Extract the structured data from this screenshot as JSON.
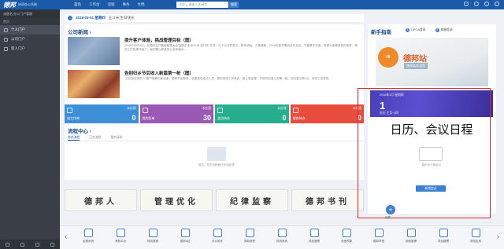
{
  "app": {
    "logo": "德邦",
    "subtitle": "协同办公系统"
  },
  "topnav": [
    "首页",
    "工作台",
    "流程",
    "事务",
    "文档"
  ],
  "search": {
    "placeholder": "请输入关键字",
    "scope": "全部",
    "button": "搜索"
  },
  "sidebar": {
    "user": "流量名  办公门户管理",
    "section": "首页",
    "items": [
      {
        "label": "个人门户",
        "active": true
      },
      {
        "label": "公司门户",
        "active": false
      },
      {
        "label": "新人门户",
        "active": false
      }
    ]
  },
  "datebar": {
    "date": "2018-03-01 星期四",
    "greeting": "五斗米,生日快乐"
  },
  "news": {
    "title": "公司新闻",
    "items": [
      {
        "headline": "提升客户体验，挑战管理目标（图）",
        "body": "2018年2月28日，在德邦召开集团管理大会\"服务的未来2018-创行年\"文件，以下为文件原文：新年伊始，万象更新。2018年春节期间召开会议，不管是本年度，希望大家都有新的收获，新的工作热情开始了。我们要以积极的心态来面对..."
      },
      {
        "headline": "告别归乡节后收入新篇第一枪（图）",
        "body": "\"文化宣传家的人\"春节假期归家结束，德邦节后服务，全国各地走访人员，顺利到岗工作状态，踏上新征程，打响节后收入的第一枪。四月复业第 (2)，好员工的表现..."
      }
    ]
  },
  "tiles": [
    {
      "label": "加工作单",
      "tag": "未处理",
      "value": "0",
      "color": "#3d8fd8"
    },
    {
      "label": "我的签单",
      "tag": "未处理",
      "value": "30",
      "color": "#9b59b6"
    },
    {
      "label": "会员待办",
      "tag": "未处理",
      "value": "0",
      "color": "#27ae8f"
    },
    {
      "label": "催收待办",
      "tag": "未处理",
      "value": "0",
      "color": "#e74c3c"
    }
  ],
  "flow": {
    "title": "流程中心",
    "tabs": [
      "待办流程",
      "已办流程",
      "我的请求"
    ],
    "empty": "暂无，您的流程都已完成处理"
  },
  "banners": [
    "德邦人",
    "管理优化",
    "纪律监察",
    "德邦书刊"
  ],
  "guide": {
    "title": "新手指南",
    "steps": [
      {
        "n": "1",
        "label": "OPOA登录"
      },
      {
        "n": "2",
        "label": "邮箱登录"
      }
    ],
    "promo": {
      "circle": "Hi",
      "text": "德邦站",
      "sub": "德邦站欢迎您"
    }
  },
  "calendar": {
    "month": "2018年3月 星期四",
    "day": "1",
    "weekday": "农历 正月十四",
    "headline": "日历、会议日程",
    "empty": "暂时无日程会议",
    "button": "新增会议"
  },
  "add": {
    "symbol": "+",
    "label": "新建"
  },
  "dock": {
    "prev": "‹",
    "next": "›",
    "items": [
      "证照系统",
      "考勤平台",
      "财务报销",
      "德邦e站",
      "办公助手",
      "德邦食堂",
      "物流系统",
      "质检管理",
      "全面预算",
      "德邦学堂",
      "网络管理",
      "项目管理",
      "添加应用"
    ]
  },
  "colors": {
    "brand": "#1b5aa8",
    "accent": "#3d7fd1",
    "highlight": "#d6282e"
  }
}
